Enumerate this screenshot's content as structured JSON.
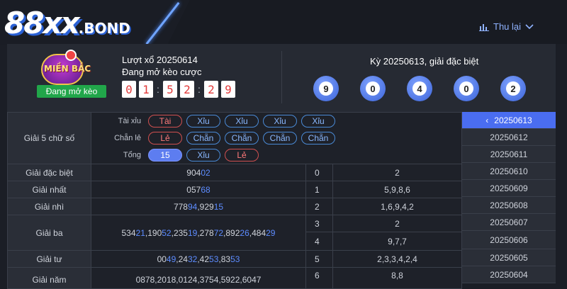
{
  "header": {
    "logo_main": "88xx",
    "logo_domain": ".BOND",
    "replay_label": "Thu lại"
  },
  "draw": {
    "badge_text": "MIỀN BẮC",
    "open_tag": "Đang mở kèo",
    "turn_label": "Lượt xổ 20250614",
    "status": "Đang mở kèo cược",
    "timer": [
      "0",
      "1",
      "5",
      "2",
      "2",
      "9"
    ],
    "prev_label": "Kỳ 20250613, giải đặc biệt",
    "balls": [
      "9",
      "0",
      "4",
      "0",
      "2"
    ]
  },
  "filters": {
    "title": "Giải 5 chữ số",
    "rows": [
      {
        "label": "Tài xỉu",
        "chips": [
          "Tài",
          "Xỉu",
          "Xỉu",
          "Xỉu",
          "Xỉu"
        ]
      },
      {
        "label": "Chẵn lẻ",
        "chips": [
          "Lẻ",
          "Chẵn",
          "Chẵn",
          "Chẵn",
          "Chẵn"
        ]
      },
      {
        "label": "Tổng",
        "chips": [
          "15",
          "Xỉu",
          "Lẻ"
        ]
      }
    ]
  },
  "prizes": [
    {
      "name": "Giải đặc biệt",
      "plain": [
        "904"
      ],
      "hl": [
        "02"
      ]
    },
    {
      "name": "Giải nhất",
      "plain": [
        "057"
      ],
      "hl": [
        "68"
      ]
    },
    {
      "name": "Giải nhì",
      "plain": [
        "778",
        ",929"
      ],
      "hl": [
        "94",
        "15"
      ]
    },
    {
      "name": "Giải ba",
      "plain": [
        "534",
        ",190",
        ",235",
        ",278",
        ",892",
        ",484"
      ],
      "hl": [
        "21",
        "52",
        "19",
        "72",
        "26",
        "29"
      ]
    },
    {
      "name": "Giải tư",
      "plain": [
        "00",
        ",24",
        ",42",
        ",83"
      ],
      "hl": [
        "49",
        "32",
        "53",
        "53"
      ]
    },
    {
      "name": "Giải năm",
      "plain": [
        "0878,2018,0124,3754,5922,6047"
      ],
      "hl": []
    }
  ],
  "heads": [
    {
      "head": "0",
      "tails": "2"
    },
    {
      "head": "1",
      "tails": "5,9,8,6"
    },
    {
      "head": "2",
      "tails": "1,6,9,4,2"
    },
    {
      "head": "3",
      "tails": "2"
    },
    {
      "head": "4",
      "tails": "9,7,7"
    },
    {
      "head": "5",
      "tails": "2,3,3,4,2,4"
    },
    {
      "head": "6",
      "tails": "8,8"
    }
  ],
  "dates": [
    "20250613",
    "20250612",
    "20250611",
    "20250610",
    "20250609",
    "20250608",
    "20250607",
    "20250606",
    "20250605",
    "20250604"
  ],
  "colors": {
    "accent": "#4a6df0",
    "highlight_digits": "#5d8cff",
    "timer_digit": "#e23b3b",
    "open_tag": "#21a64a"
  }
}
